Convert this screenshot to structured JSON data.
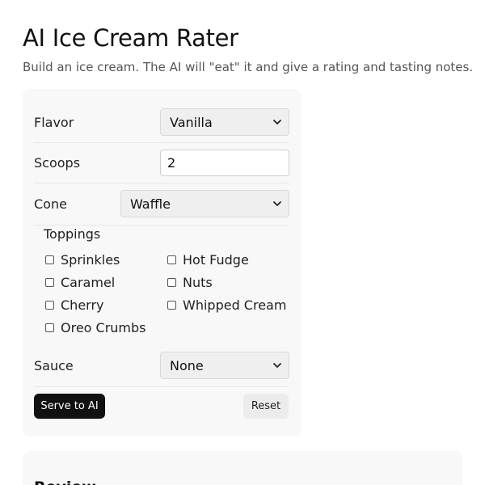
{
  "header": {
    "title": "AI Ice Cream Rater",
    "subtitle": "Build an ice cream. The AI will \"eat\" it and give a rating and tasting notes."
  },
  "form": {
    "flavor": {
      "label": "Flavor",
      "value": "Vanilla"
    },
    "scoops": {
      "label": "Scoops",
      "value": "2"
    },
    "cone": {
      "label": "Cone",
      "value": "Waffle"
    },
    "toppings": {
      "label": "Toppings",
      "items": [
        {
          "label": "Sprinkles",
          "checked": false
        },
        {
          "label": "Hot Fudge",
          "checked": false
        },
        {
          "label": "Caramel",
          "checked": false
        },
        {
          "label": "Nuts",
          "checked": false
        },
        {
          "label": "Cherry",
          "checked": false
        },
        {
          "label": "Whipped Cream",
          "checked": false
        },
        {
          "label": "Oreo Crumbs",
          "checked": false
        }
      ]
    },
    "sauce": {
      "label": "Sauce",
      "value": "None"
    },
    "serve_label": "Serve to AI",
    "reset_label": "Reset"
  },
  "review": {
    "heading": "Review"
  }
}
